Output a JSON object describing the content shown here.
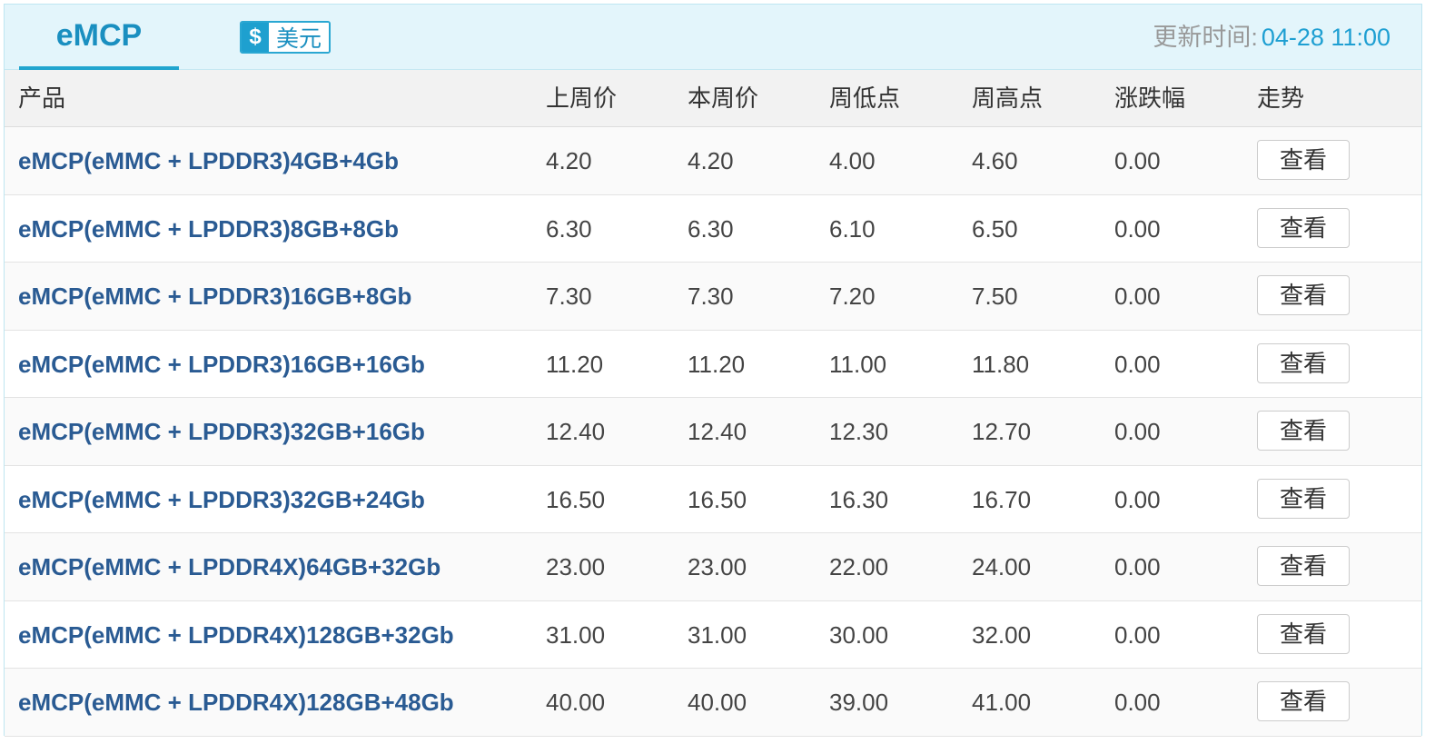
{
  "header": {
    "tab_label": "eMCP",
    "currency": {
      "icon": "dollar-icon",
      "symbol": "$",
      "label": "美元"
    },
    "update_label": "更新时间:",
    "update_value": "04-28 11:00"
  },
  "columns": [
    "产品",
    "上周价",
    "本周价",
    "周低点",
    "周高点",
    "涨跌幅",
    "走势"
  ],
  "view_label": "查看",
  "rows": [
    {
      "product": "eMCP(eMMC + LPDDR3)4GB+4Gb",
      "last_week": "4.20",
      "this_week": "4.20",
      "low": "4.00",
      "high": "4.60",
      "change": "0.00"
    },
    {
      "product": "eMCP(eMMC + LPDDR3)8GB+8Gb",
      "last_week": "6.30",
      "this_week": "6.30",
      "low": "6.10",
      "high": "6.50",
      "change": "0.00"
    },
    {
      "product": "eMCP(eMMC + LPDDR3)16GB+8Gb",
      "last_week": "7.30",
      "this_week": "7.30",
      "low": "7.20",
      "high": "7.50",
      "change": "0.00"
    },
    {
      "product": "eMCP(eMMC + LPDDR3)16GB+16Gb",
      "last_week": "11.20",
      "this_week": "11.20",
      "low": "11.00",
      "high": "11.80",
      "change": "0.00"
    },
    {
      "product": "eMCP(eMMC + LPDDR3)32GB+16Gb",
      "last_week": "12.40",
      "this_week": "12.40",
      "low": "12.30",
      "high": "12.70",
      "change": "0.00"
    },
    {
      "product": "eMCP(eMMC + LPDDR3)32GB+24Gb",
      "last_week": "16.50",
      "this_week": "16.50",
      "low": "16.30",
      "high": "16.70",
      "change": "0.00"
    },
    {
      "product": "eMCP(eMMC + LPDDR4X)64GB+32Gb",
      "last_week": "23.00",
      "this_week": "23.00",
      "low": "22.00",
      "high": "24.00",
      "change": "0.00"
    },
    {
      "product": "eMCP(eMMC + LPDDR4X)128GB+32Gb",
      "last_week": "31.00",
      "this_week": "31.00",
      "low": "30.00",
      "high": "32.00",
      "change": "0.00"
    },
    {
      "product": "eMCP(eMMC + LPDDR4X)128GB+48Gb",
      "last_week": "40.00",
      "this_week": "40.00",
      "low": "39.00",
      "high": "41.00",
      "change": "0.00"
    }
  ]
}
